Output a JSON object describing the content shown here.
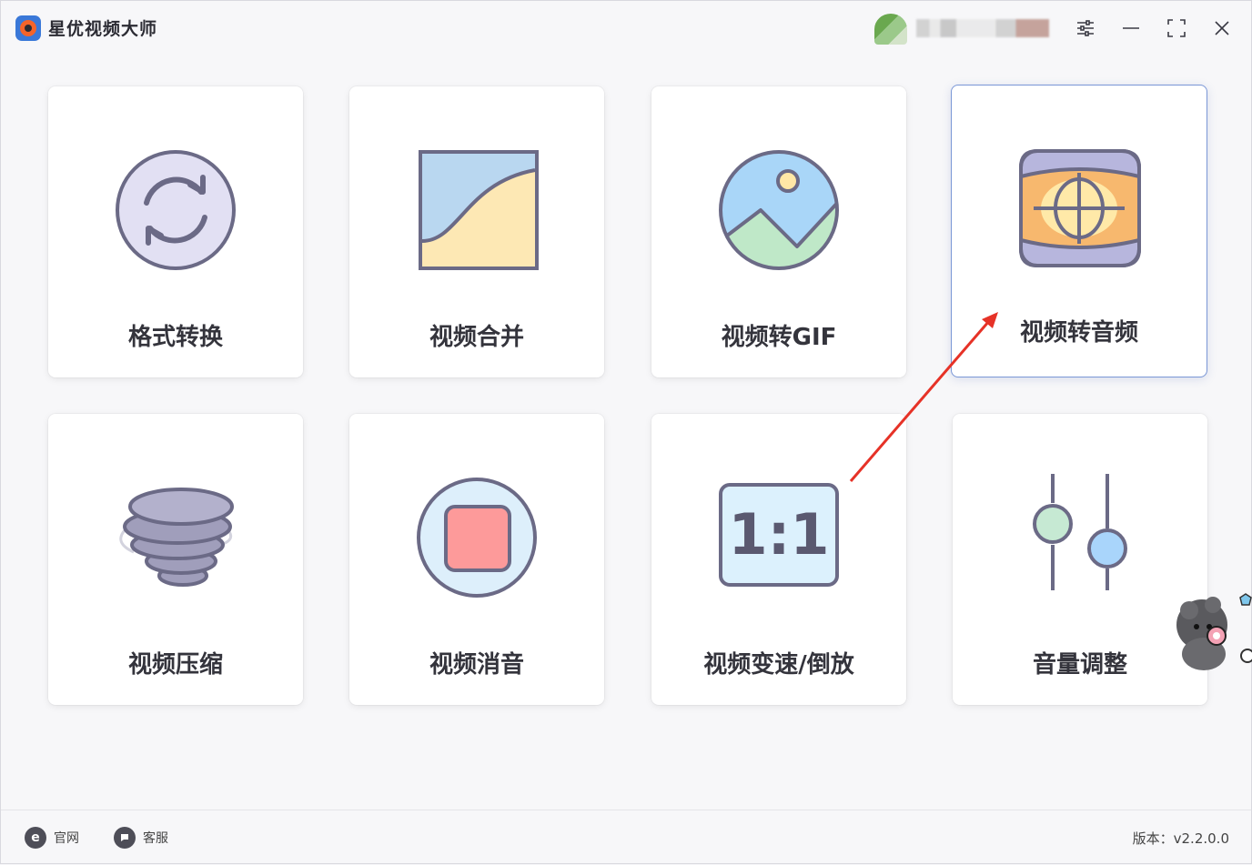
{
  "app": {
    "title": "星优视频大师"
  },
  "colors": {
    "accent": "#7a97d6",
    "arrow": "#e63227",
    "text": "#34343c"
  },
  "header_icons": [
    "user-avatar",
    "settings-sliders-icon",
    "minimize-icon",
    "maximize-icon",
    "close-icon"
  ],
  "cards": [
    {
      "label": "格式转换",
      "icon": "convert-icon"
    },
    {
      "label": "视频合并",
      "icon": "merge-icon"
    },
    {
      "label": "视频转GIF",
      "icon": "image-icon"
    },
    {
      "label": "视频转音频",
      "icon": "globe-audio-icon"
    },
    {
      "label": "视频压缩",
      "icon": "tornado-icon"
    },
    {
      "label": "视频消音",
      "icon": "stop-icon"
    },
    {
      "label": "视频变速/倒放",
      "icon": "ratio-icon"
    },
    {
      "label": "音量调整",
      "icon": "volume-sliders-icon"
    }
  ],
  "ratio_text": "1:1",
  "footer": {
    "website_label": "官网",
    "support_label": "客服",
    "version": "版本：v2.2.0.0"
  }
}
